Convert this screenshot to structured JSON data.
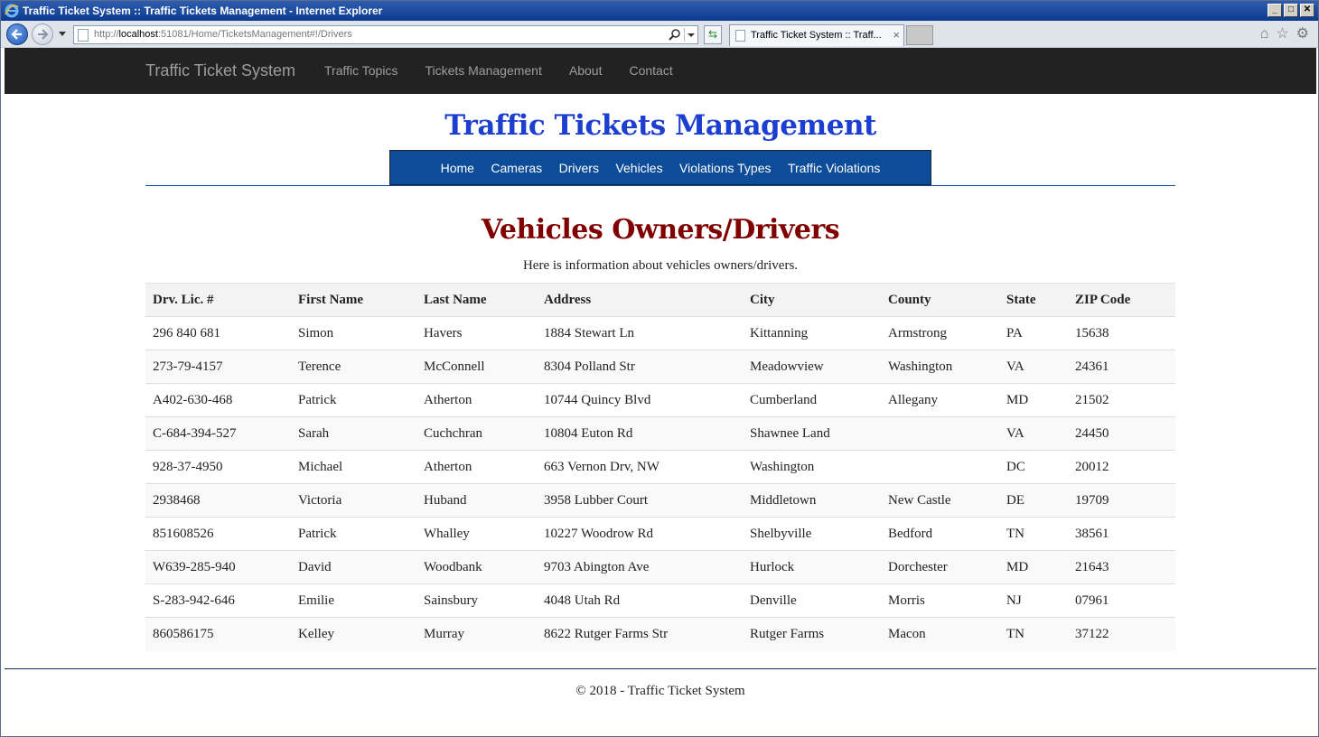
{
  "window": {
    "title": "Traffic Ticket System :: Traffic Tickets Management - Internet Explorer",
    "controls": [
      "minimize",
      "maximize",
      "close"
    ]
  },
  "browser": {
    "url_prefix": "http://",
    "url_host": "localhost",
    "url_rest": ":51081/Home/TicketsManagement#!/Drivers",
    "tab_label": "Traffic Ticket System :: Traff...",
    "tab_close": "×",
    "icons": [
      "back-icon",
      "forward-icon",
      "search-icon",
      "refresh-icon",
      "home-icon",
      "favorites-star-icon",
      "settings-gear-icon"
    ]
  },
  "navbar": {
    "brand": "Traffic Ticket System",
    "links": [
      "Traffic Topics",
      "Tickets Management",
      "About",
      "Contact"
    ]
  },
  "site": {
    "title": "Traffic Tickets Management",
    "title_color": "#1d3fcf",
    "sub_nav": [
      "Home",
      "Cameras",
      "Drivers",
      "Vehicles",
      "Violations Types",
      "Traffic Violations"
    ],
    "sub_nav_bg": "#0d4c99"
  },
  "page": {
    "heading": "Vehicles Owners/Drivers",
    "heading_color": "#800000",
    "intro": "Here is information about vehicles owners/drivers."
  },
  "table": {
    "headers": [
      "Drv. Lic. #",
      "First Name",
      "Last Name",
      "Address",
      "City",
      "County",
      "State",
      "ZIP Code"
    ],
    "rows": [
      [
        "296 840 681",
        "Simon",
        "Havers",
        "1884 Stewart Ln",
        "Kittanning",
        "Armstrong",
        "PA",
        "15638"
      ],
      [
        "273-79-4157",
        "Terence",
        "McConnell",
        "8304 Polland Str",
        "Meadowview",
        "Washington",
        "VA",
        "24361"
      ],
      [
        "A402-630-468",
        "Patrick",
        "Atherton",
        "10744 Quincy Blvd",
        "Cumberland",
        "Allegany",
        "MD",
        "21502"
      ],
      [
        "C-684-394-527",
        "Sarah",
        "Cuchchran",
        "10804 Euton Rd",
        "Shawnee Land",
        "",
        "VA",
        "24450"
      ],
      [
        "928-37-4950",
        "Michael",
        "Atherton",
        "663 Vernon Drv, NW",
        "Washington",
        "",
        "DC",
        "20012"
      ],
      [
        "2938468",
        "Victoria",
        "Huband",
        "3958 Lubber Court",
        "Middletown",
        "New Castle",
        "DE",
        "19709"
      ],
      [
        "851608526",
        "Patrick",
        "Whalley",
        "10227 Woodrow Rd",
        "Shelbyville",
        "Bedford",
        "TN",
        "38561"
      ],
      [
        "W639-285-940",
        "David",
        "Woodbank",
        "9703 Abington Ave",
        "Hurlock",
        "Dorchester",
        "MD",
        "21643"
      ],
      [
        "S-283-942-646",
        "Emilie",
        "Sainsbury",
        "4048 Utah Rd",
        "Denville",
        "Morris",
        "NJ",
        "07961"
      ],
      [
        "860586175",
        "Kelley",
        "Murray",
        "8622 Rutger Farms Str",
        "Rutger Farms",
        "Macon",
        "TN",
        "37122"
      ]
    ]
  },
  "footer": {
    "text": "© 2018 - Traffic Ticket System"
  }
}
